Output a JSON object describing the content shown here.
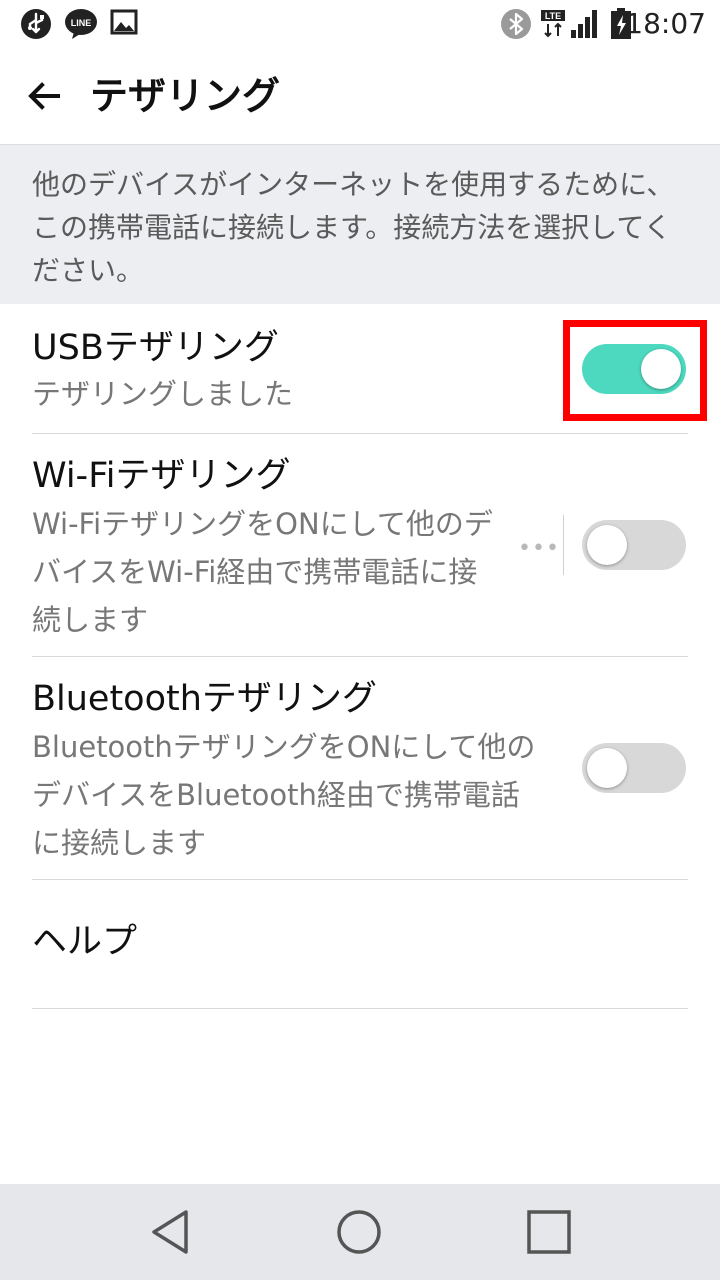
{
  "status_bar": {
    "time": "18:07",
    "icons": [
      "usb-icon",
      "line-icon",
      "image-icon",
      "bluetooth-icon",
      "lte-icon",
      "signal-icon",
      "battery-icon"
    ],
    "line_label": "LINE",
    "lte_label": "LTE"
  },
  "app_bar": {
    "title": "テザリング"
  },
  "description": "他のデバイスがインターネットを使用するために、この携帯電話に接続します。接続方法を選択してください。",
  "settings": {
    "usb": {
      "title": "USBテザリング",
      "subtitle": "テザリングしました",
      "enabled": true
    },
    "wifi": {
      "title": "Wi-Fiテザリング",
      "subtitle": "Wi-FiテザリングをONにして他のデバイスをWi-Fi経由で携帯電話に接続します",
      "more": "•••",
      "enabled": false
    },
    "bluetooth": {
      "title": "Bluetoothテザリング",
      "subtitle": "BluetoothテザリングをONにして他のデバイスをBluetooth経由で携帯電話に接続します",
      "enabled": false
    },
    "help": {
      "title": "ヘルプ"
    }
  },
  "colors": {
    "toggle_on": "#4dd9bf",
    "toggle_off": "#d8d8d8",
    "highlight": "#ff0000",
    "description_bg": "#eceef1",
    "nav_bar_bg": "#e6e7ea"
  },
  "nav_bar": [
    "back-icon",
    "home-icon",
    "recents-icon"
  ]
}
